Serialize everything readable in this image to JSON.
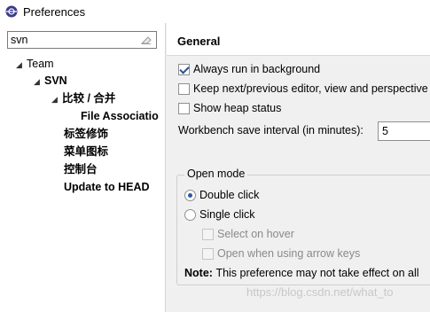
{
  "window": {
    "title": "Preferences"
  },
  "filter": {
    "value": "svn"
  },
  "tree": {
    "team": "Team",
    "svn": "SVN",
    "compare_merge": "比较 / 合并",
    "file_associations": "File Associatio",
    "label_decorations": "标签修饰",
    "menu_icons": "菜单图标",
    "console": "控制台",
    "update_to_head": "Update to HEAD"
  },
  "page": {
    "title": "General",
    "always_run_background": {
      "label": "Always run in background",
      "checked": true
    },
    "keep_next_prev": {
      "label": "Keep next/previous editor, view and perspective",
      "checked": false
    },
    "show_heap": {
      "label": "Show heap status",
      "checked": false
    },
    "save_interval": {
      "label": "Workbench save interval (in minutes):",
      "value": "5"
    },
    "open_mode": {
      "title": "Open mode",
      "double_click": "Double click",
      "single_click": "Single click",
      "selected": "Double click",
      "select_on_hover": "Select on hover",
      "open_with_arrows": "Open when using arrow keys",
      "note_label": "Note:",
      "note_text": "This preference may not take effect on all"
    }
  },
  "watermark": "https://blog.csdn.net/what_to"
}
